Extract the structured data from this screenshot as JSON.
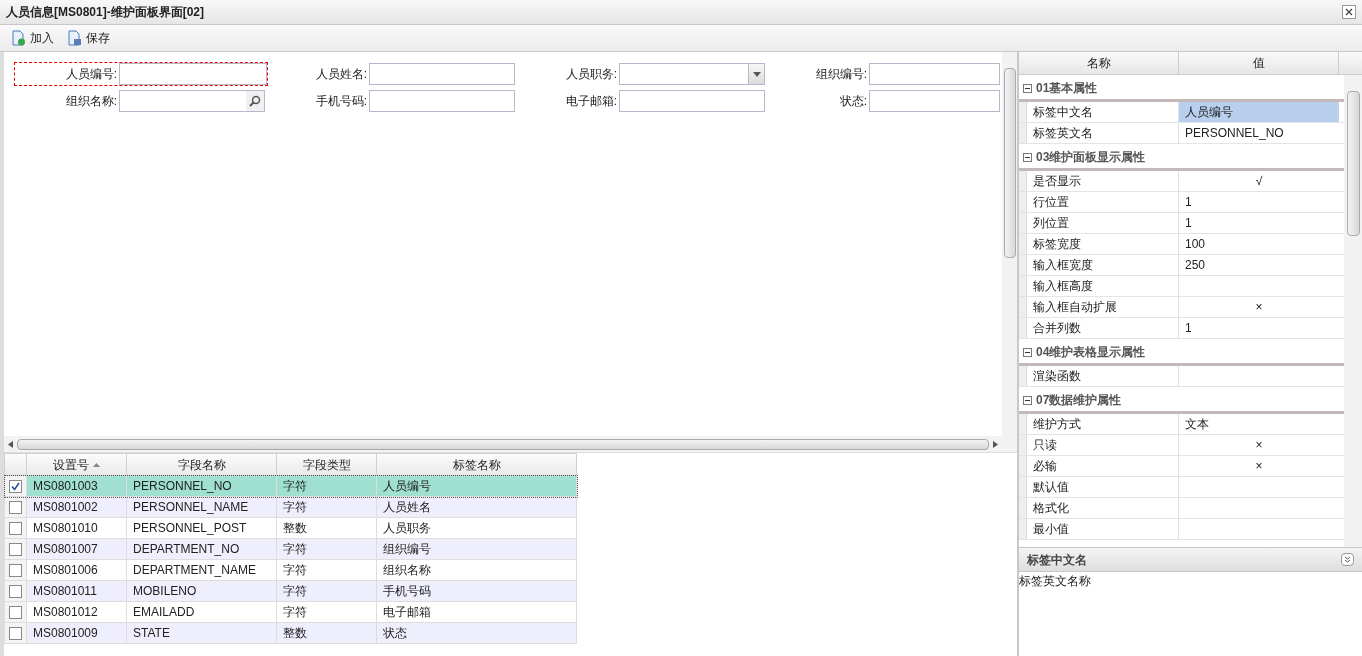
{
  "window": {
    "title": "人员信息[MS0801]-维护面板界面[02]"
  },
  "toolbar": [
    {
      "label": "加入",
      "kind": "add"
    },
    {
      "label": "保存",
      "kind": "save"
    }
  ],
  "form": {
    "rows": [
      [
        {
          "label": "人员编号:",
          "kind": "text",
          "focused": true
        },
        {
          "label": "人员姓名:",
          "kind": "text",
          "focused": false
        },
        {
          "label": "人员职务:",
          "kind": "select",
          "focused": false
        },
        {
          "label": "组织编号:",
          "kind": "text",
          "focused": false
        }
      ],
      [
        {
          "label": "组织名称:",
          "kind": "search",
          "focused": false
        },
        {
          "label": "手机号码:",
          "kind": "text",
          "focused": false
        },
        {
          "label": "电子邮箱:",
          "kind": "text",
          "focused": false
        },
        {
          "label": "状态:",
          "kind": "text",
          "focused": false
        }
      ]
    ]
  },
  "grid": {
    "columns": [
      {
        "label": "设置号",
        "sorted": true
      },
      {
        "label": "字段名称",
        "sorted": false
      },
      {
        "label": "字段类型",
        "sorted": false
      },
      {
        "label": "标签名称",
        "sorted": false
      }
    ],
    "rows": [
      {
        "checked": true,
        "selected": true,
        "cells": [
          "MS0801003",
          "PERSONNEL_NO",
          "字符",
          "人员编号"
        ]
      },
      {
        "checked": false,
        "selected": false,
        "cells": [
          "MS0801002",
          "PERSONNEL_NAME",
          "字符",
          "人员姓名"
        ]
      },
      {
        "checked": false,
        "selected": false,
        "cells": [
          "MS0801010",
          "PERSONNEL_POST",
          "整数",
          "人员职务"
        ]
      },
      {
        "checked": false,
        "selected": false,
        "cells": [
          "MS0801007",
          "DEPARTMENT_NO",
          "字符",
          "组织编号"
        ]
      },
      {
        "checked": false,
        "selected": false,
        "cells": [
          "MS0801006",
          "DEPARTMENT_NAME",
          "字符",
          "组织名称"
        ]
      },
      {
        "checked": false,
        "selected": false,
        "cells": [
          "MS0801011",
          "MOBILENO",
          "字符",
          "手机号码"
        ]
      },
      {
        "checked": false,
        "selected": false,
        "cells": [
          "MS0801012",
          "EMAILADD",
          "字符",
          "电子邮箱"
        ]
      },
      {
        "checked": false,
        "selected": false,
        "cells": [
          "MS0801009",
          "STATE",
          "整数",
          "状态"
        ]
      }
    ]
  },
  "properties": {
    "columns": [
      "名称",
      "值"
    ],
    "groups": [
      {
        "title": "01基本属性",
        "expanded": true,
        "rows": [
          {
            "name": "标签中文名",
            "value": "人员编号",
            "kind": "text",
            "selected": true
          },
          {
            "name": "标签英文名",
            "value": "PERSONNEL_NO",
            "kind": "text",
            "selected": false
          }
        ]
      },
      {
        "title": "03维护面板显示属性",
        "expanded": true,
        "rows": [
          {
            "name": "是否显示",
            "value": "√",
            "kind": "flag",
            "selected": false
          },
          {
            "name": "行位置",
            "value": "1",
            "kind": "text",
            "selected": false
          },
          {
            "name": "列位置",
            "value": "1",
            "kind": "text",
            "selected": false
          },
          {
            "name": "标签宽度",
            "value": "100",
            "kind": "text",
            "selected": false
          },
          {
            "name": "输入框宽度",
            "value": "250",
            "kind": "text",
            "selected": false
          },
          {
            "name": "输入框高度",
            "kind": "text",
            "selected": false
          },
          {
            "name": "输入框自动扩展",
            "value": "×",
            "kind": "flag",
            "selected": false
          },
          {
            "name": "合并列数",
            "value": "1",
            "kind": "text",
            "selected": false
          }
        ]
      },
      {
        "title": "04维护表格显示属性",
        "expanded": true,
        "rows": [
          {
            "name": "渲染函数",
            "kind": "text",
            "selected": false
          }
        ]
      },
      {
        "title": "07数据维护属性",
        "expanded": true,
        "rows": [
          {
            "name": "维护方式",
            "value": "文本",
            "kind": "text",
            "selected": false
          },
          {
            "name": "只读",
            "value": "×",
            "kind": "flag",
            "selected": false
          },
          {
            "name": "必输",
            "value": "×",
            "kind": "flag",
            "selected": false
          },
          {
            "name": "默认值",
            "kind": "text",
            "selected": false
          },
          {
            "name": "格式化",
            "kind": "text",
            "selected": false
          },
          {
            "name": "最小值",
            "kind": "text",
            "selected": false
          }
        ]
      }
    ]
  },
  "description": {
    "title": "标签中文名",
    "text": "标签英文名称"
  }
}
